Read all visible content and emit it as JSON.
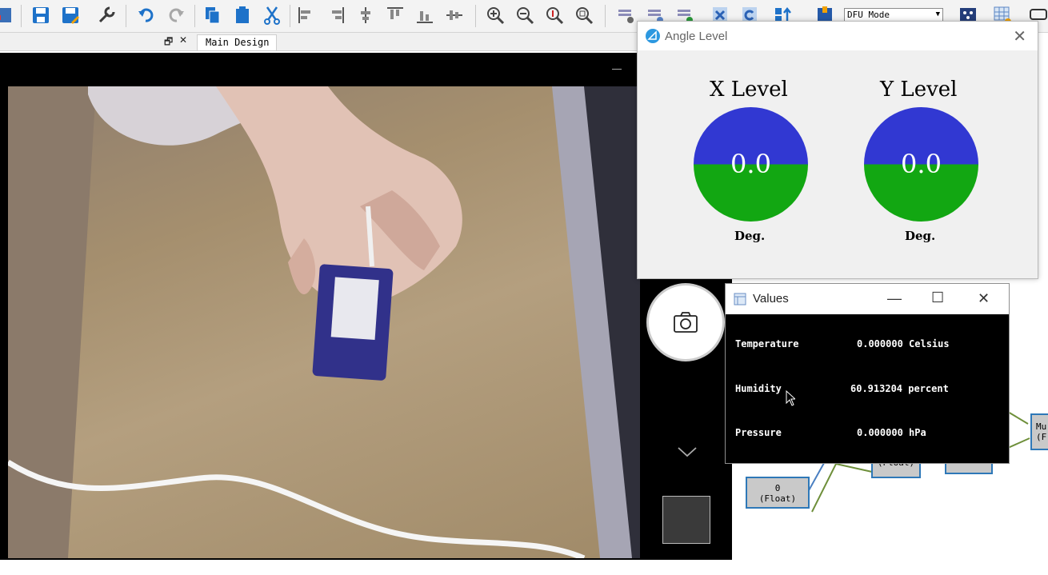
{
  "toolbar": {
    "mode_select": "DFU Mode"
  },
  "panel": {
    "float_glyph": "🗗",
    "close_glyph": "✕"
  },
  "editor": {
    "tabs": [
      {
        "label": "Main Design"
      }
    ]
  },
  "diagram": {
    "nodes": [
      {
        "label": "0"
      },
      {
        "label": "(Float)"
      },
      {
        "label": "(Float)"
      },
      {
        "label": "Mu"
      },
      {
        "label": "(F"
      }
    ]
  },
  "angle_window": {
    "title": "Angle Level",
    "close_glyph": "✕",
    "x": {
      "label": "X Level",
      "value": "0.0",
      "unit": "Deg."
    },
    "y": {
      "label": "Y Level",
      "value": "0.0",
      "unit": "Deg."
    },
    "colors": {
      "upper": "#3138d2",
      "lower": "#12a712"
    }
  },
  "values_window": {
    "title": "Values",
    "rows": [
      {
        "name": "Temperature",
        "value": "0.000000 Celsius"
      },
      {
        "name": "Humidity",
        "value": "60.913204 percent"
      },
      {
        "name": "Pressure",
        "value": "0.000000 hPa"
      }
    ]
  },
  "camera": {
    "icon": "camera-icon"
  }
}
